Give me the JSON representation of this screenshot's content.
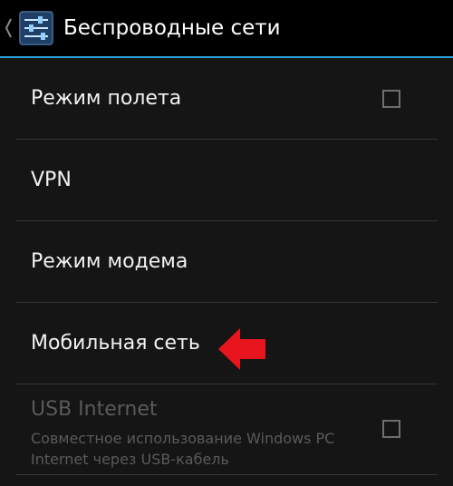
{
  "action_bar": {
    "title": "Беспроводные сети",
    "up_icon": "chevron-left-icon",
    "app_icon": "settings-sliders-icon",
    "accent_color": "#2a9ed8"
  },
  "settings": {
    "airplane_mode": {
      "label": "Режим полета",
      "checked": false
    },
    "vpn": {
      "label": "VPN"
    },
    "tethering": {
      "label": "Режим модема"
    },
    "mobile_network": {
      "label": "Мобильная сеть"
    },
    "usb_internet": {
      "label": "USB Internet",
      "summary": "Совместное использование Windows PC Internet через USB-кабель",
      "checked": false,
      "enabled": false
    }
  },
  "annotation": {
    "icon": "red-arrow-left-icon",
    "color": "#e8141e"
  }
}
